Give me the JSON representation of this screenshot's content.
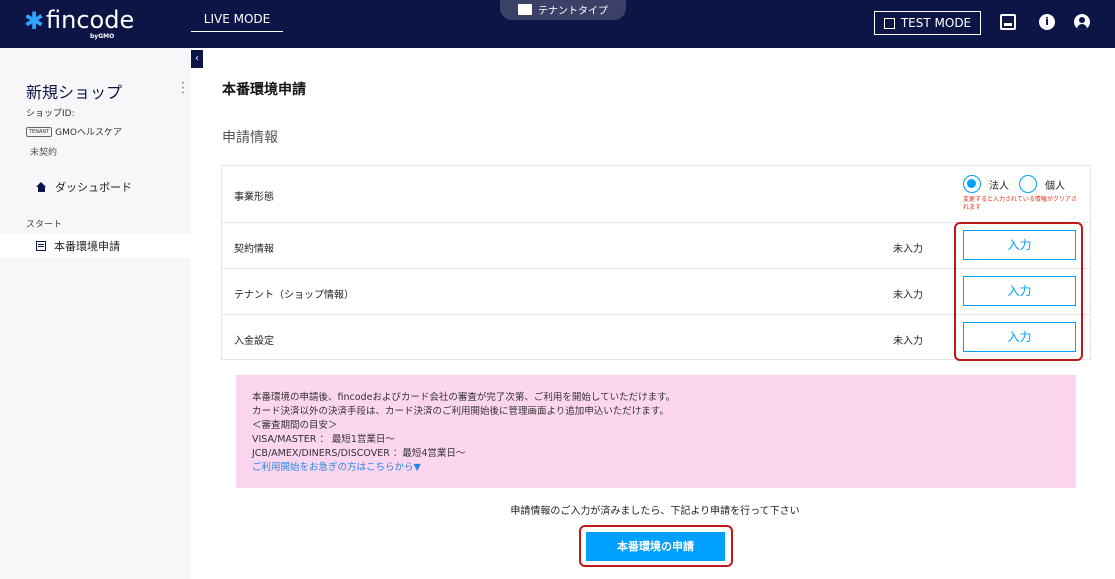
{
  "header": {
    "logo_text": "fincode",
    "logo_sub": "byGMO",
    "live_mode": "LIVE MODE",
    "tenant_type": "テナントタイプ",
    "test_mode": "TEST MODE",
    "info_icon": "i",
    "colors": {
      "bar": "#0d1547",
      "accent": "#00a0ff"
    }
  },
  "sidebar": {
    "collapse_icon": "‹",
    "shop_name": "新規ショップ",
    "menu_icon": "⋮",
    "shop_id_label": "ショップID:",
    "tenant_tag": "TENANT",
    "tenant_name": "GMOヘルスケア",
    "contract_status": "未契約",
    "dashboard_label": "ダッシュボード",
    "section_start": "スタート",
    "apply_label": "本番環境申請"
  },
  "main": {
    "page_title": "本番環境申請",
    "section_title": "申請情報",
    "business_type": {
      "label": "事業形態",
      "options": [
        "法人",
        "個人"
      ],
      "selected": "法人",
      "note": "変更すると入力されている情報がクリアされます"
    },
    "rows": [
      {
        "label": "契約情報",
        "status": "未入力",
        "button": "入力"
      },
      {
        "label": "テナント（ショップ情報）",
        "status": "未入力",
        "button": "入力"
      },
      {
        "label": "入金設定",
        "status": "未入力",
        "button": "入力"
      }
    ],
    "notice": {
      "line1": "本番環境の申請後、fincodeおよびカード会社の審査が完了次第、ご利用を開始していただけます。",
      "line2": "カード決済以外の決済手段は、カード決済のご利用開始後に管理画面より追加申込いただけます。",
      "line3": "＜審査期間の目安＞",
      "line4": "VISA/MASTER ： 最短1営業日〜",
      "line5": "JCB/AMEX/DINERS/DISCOVER ：最短4営業日〜",
      "link": "ご利用開始をお急ぎの方はこちらから▼"
    },
    "footer_message": "申請情報のご入力が済みましたら、下記より申請を行って下さい",
    "submit_label": "本番環境の申請"
  }
}
